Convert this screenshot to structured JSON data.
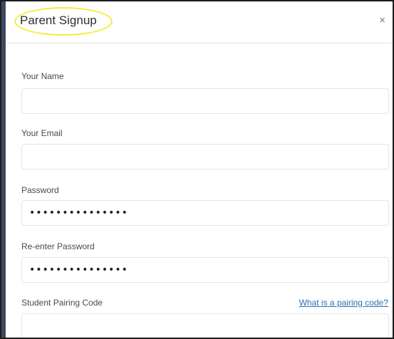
{
  "dialog": {
    "title": "Parent Signup",
    "close_label": "×"
  },
  "form": {
    "name": {
      "label": "Your Name",
      "value": ""
    },
    "email": {
      "label": "Your Email",
      "value": ""
    },
    "password": {
      "label": "Password",
      "value": "•••••••••••••••"
    },
    "confirm_password": {
      "label": "Re-enter Password",
      "value": "•••••••••••••••"
    },
    "pairing_code": {
      "label": "Student Pairing Code",
      "value": "",
      "help_link": "What is a pairing code?"
    }
  },
  "colors": {
    "title_highlight": "#f2ee3a",
    "link": "#2a6fb5",
    "left_edge": "#3c4a63"
  }
}
